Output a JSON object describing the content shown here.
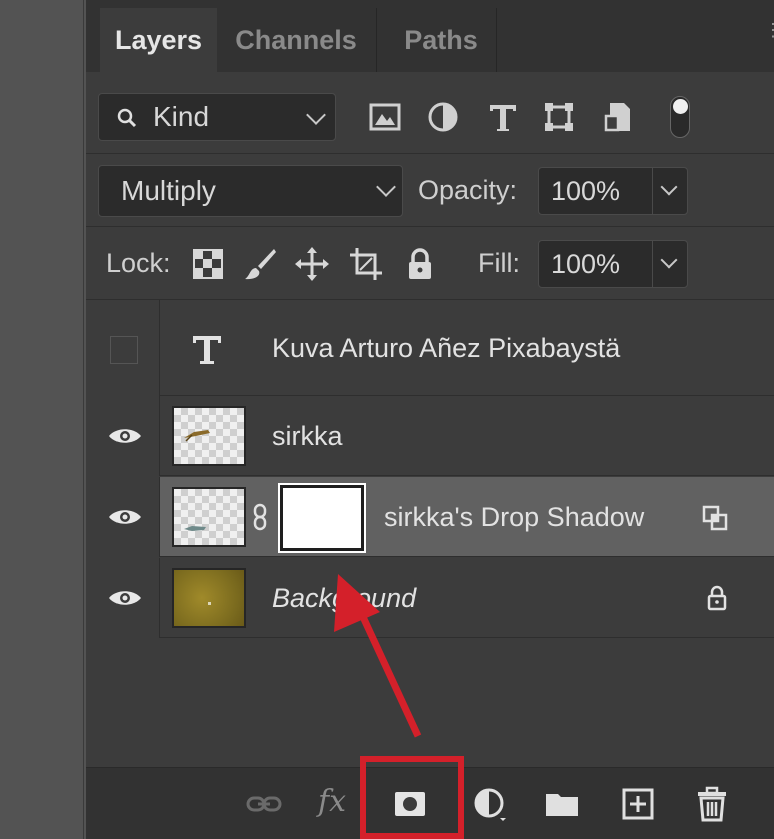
{
  "tabs": {
    "layers": "Layers",
    "channels": "Channels",
    "paths": "Paths"
  },
  "filter": {
    "kind_label": "Kind",
    "icons": [
      "image-filter-icon",
      "adjustment-filter-icon",
      "type-filter-icon",
      "shape-filter-icon",
      "smart-object-filter-icon",
      "filter-toggle-icon"
    ]
  },
  "blend": {
    "mode": "Multiply",
    "opacity_label": "Opacity:",
    "opacity_value": "100%"
  },
  "lock": {
    "label": "Lock:",
    "fill_label": "Fill:",
    "fill_value": "100%",
    "icons": [
      "lock-transparent-pixels-icon",
      "lock-image-pixels-icon",
      "lock-position-icon",
      "lock-artboard-icon",
      "lock-all-icon"
    ]
  },
  "layers": [
    {
      "name": "Kuva Arturo Añez Pixabaystä",
      "type": "text",
      "visible": false
    },
    {
      "name": "sirkka",
      "type": "pixel",
      "visible": true
    },
    {
      "name": "sirkka's Drop Shadow",
      "type": "pixel-with-mask",
      "visible": true,
      "selected": true
    },
    {
      "name": "Background",
      "type": "background",
      "visible": true,
      "locked": true
    }
  ],
  "bottom_icons": [
    "link-layers-icon",
    "fx-icon",
    "add-mask-icon",
    "adjustment-layer-icon",
    "new-group-icon",
    "new-layer-icon",
    "delete-layer-icon"
  ],
  "colors": {
    "panel": "#3c3c3c",
    "selected_row": "#616161",
    "annotation": "#d4202a"
  }
}
